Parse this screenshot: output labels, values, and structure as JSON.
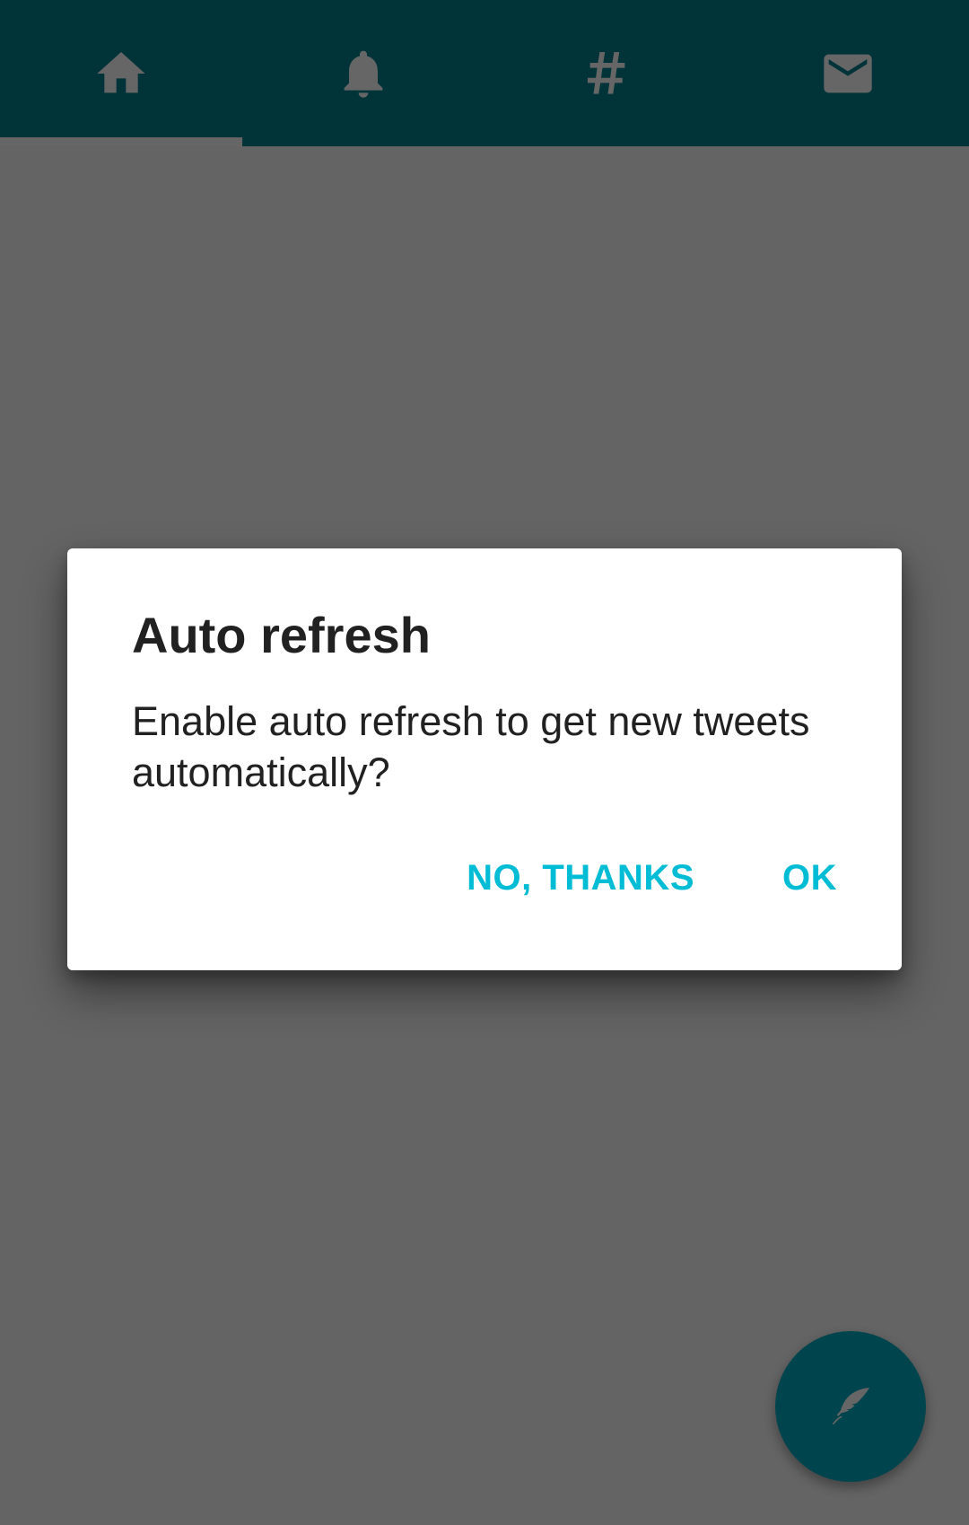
{
  "colors": {
    "toolbar": "#00838f",
    "accent": "#00bcd4",
    "fab": "#00acc1",
    "scrim": "rgba(0,0,0,0.6)"
  },
  "tabs": [
    {
      "icon": "home-icon",
      "selected": true
    },
    {
      "icon": "bell-icon",
      "selected": false
    },
    {
      "icon": "hashtag-icon",
      "selected": false
    },
    {
      "icon": "mail-icon",
      "selected": false
    }
  ],
  "fab": {
    "icon": "quill-icon"
  },
  "dialog": {
    "title": "Auto refresh",
    "message": "Enable auto refresh to get new tweets automatically?",
    "negative_label": "NO, THANKS",
    "positive_label": "OK"
  }
}
